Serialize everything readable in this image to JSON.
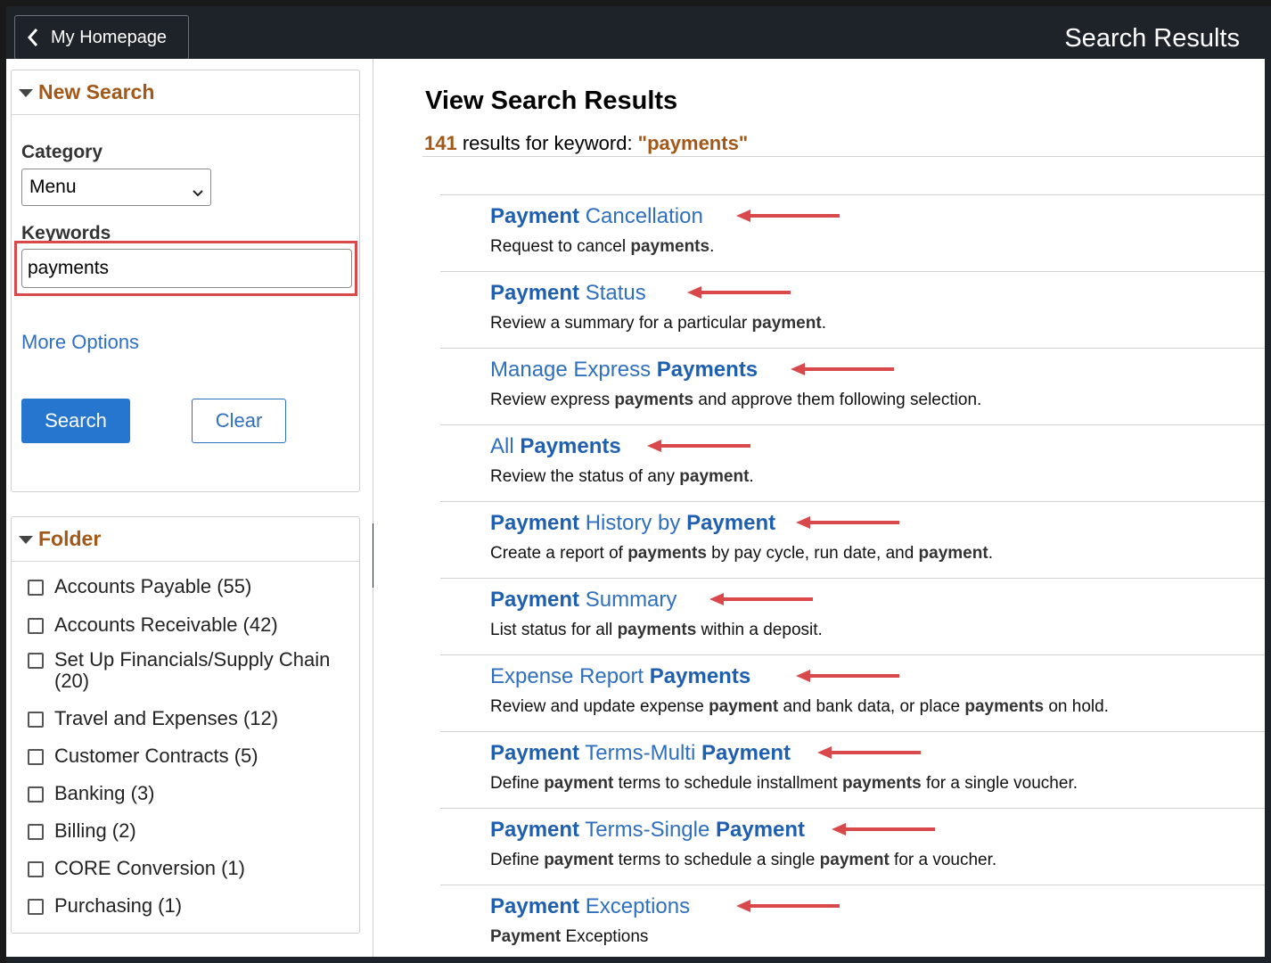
{
  "header": {
    "back_label": "My Homepage",
    "title": "Search Results"
  },
  "new_search": {
    "heading": "New Search",
    "category_label": "Category",
    "category_value": "Menu",
    "keywords_label": "Keywords",
    "keywords_value": "payments",
    "more_options": "More Options",
    "search_button": "Search",
    "clear_button": "Clear"
  },
  "folder": {
    "heading": "Folder",
    "items": [
      {
        "label": "Accounts Payable (55)"
      },
      {
        "label": "Accounts Receivable (42)"
      },
      {
        "label": "Set Up Financials/Supply Chain (20)"
      },
      {
        "label": "Travel and Expenses (12)"
      },
      {
        "label": "Customer Contracts (5)"
      },
      {
        "label": "Banking (3)"
      },
      {
        "label": "Billing (2)"
      },
      {
        "label": "CORE Conversion (1)"
      },
      {
        "label": "Purchasing (1)"
      }
    ]
  },
  "main": {
    "title": "View Search Results",
    "count": "141",
    "summary_text": " results for keyword: ",
    "keyword": "\"payments\"",
    "results": [
      {
        "title": [
          [
            "Payment",
            true
          ],
          [
            " Cancellation",
            false
          ]
        ],
        "desc": [
          [
            "Request to cancel ",
            false
          ],
          [
            "payments",
            true
          ],
          [
            ".",
            false
          ]
        ]
      },
      {
        "title": [
          [
            "Payment",
            true
          ],
          [
            " Status",
            false
          ]
        ],
        "desc": [
          [
            "Review a summary for a particular ",
            false
          ],
          [
            "payment",
            true
          ],
          [
            ".",
            false
          ]
        ]
      },
      {
        "title": [
          [
            "Manage Express ",
            false
          ],
          [
            "Payments",
            true
          ]
        ],
        "desc": [
          [
            "Review express ",
            false
          ],
          [
            "payments",
            true
          ],
          [
            " and approve them following selection.",
            false
          ]
        ]
      },
      {
        "title": [
          [
            "All ",
            false
          ],
          [
            "Payments",
            true
          ]
        ],
        "desc": [
          [
            "Review the status of any ",
            false
          ],
          [
            "payment",
            true
          ],
          [
            ".",
            false
          ]
        ]
      },
      {
        "title": [
          [
            "Payment",
            true
          ],
          [
            " History by ",
            false
          ],
          [
            "Payment",
            true
          ]
        ],
        "desc": [
          [
            "Create a report of ",
            false
          ],
          [
            "payments",
            true
          ],
          [
            " by pay cycle, run date, and ",
            false
          ],
          [
            "payment",
            true
          ],
          [
            ".",
            false
          ]
        ]
      },
      {
        "title": [
          [
            "Payment",
            true
          ],
          [
            " Summary",
            false
          ]
        ],
        "desc": [
          [
            "List status for all ",
            false
          ],
          [
            "payments",
            true
          ],
          [
            " within a deposit.",
            false
          ]
        ]
      },
      {
        "title": [
          [
            "Expense Report ",
            false
          ],
          [
            "Payments",
            true
          ]
        ],
        "desc": [
          [
            "Review and update expense ",
            false
          ],
          [
            "payment",
            true
          ],
          [
            " and bank data, or place ",
            false
          ],
          [
            "payments",
            true
          ],
          [
            " on hold.",
            false
          ]
        ]
      },
      {
        "title": [
          [
            "Payment",
            true
          ],
          [
            " Terms-Multi ",
            false
          ],
          [
            "Payment",
            true
          ]
        ],
        "desc": [
          [
            "Define ",
            false
          ],
          [
            "payment",
            true
          ],
          [
            " terms to schedule installment ",
            false
          ],
          [
            "payments",
            true
          ],
          [
            " for a single voucher.",
            false
          ]
        ]
      },
      {
        "title": [
          [
            "Payment",
            true
          ],
          [
            " Terms-Single ",
            false
          ],
          [
            "Payment",
            true
          ]
        ],
        "desc": [
          [
            "Define ",
            false
          ],
          [
            "payment",
            true
          ],
          [
            " terms to schedule a single ",
            false
          ],
          [
            "payment",
            true
          ],
          [
            " for a voucher.",
            false
          ]
        ]
      },
      {
        "title": [
          [
            "Payment",
            true
          ],
          [
            " Exceptions",
            false
          ]
        ],
        "desc": [
          [
            "Payment",
            true
          ],
          [
            " Exceptions",
            false
          ]
        ]
      }
    ]
  },
  "colors": {
    "header_bg": "#1e2329",
    "accent_orange": "#a35818",
    "link_blue": "#2f6fbf",
    "button_blue": "#2675cf",
    "annotation_red": "#d9494b"
  },
  "icons": {
    "back": "chevron-left-icon",
    "dropdown": "chevron-down-icon",
    "collapse": "triangle-down-icon",
    "splitter": "pause-bars-icon",
    "annotation": "red-arrow-icon"
  }
}
